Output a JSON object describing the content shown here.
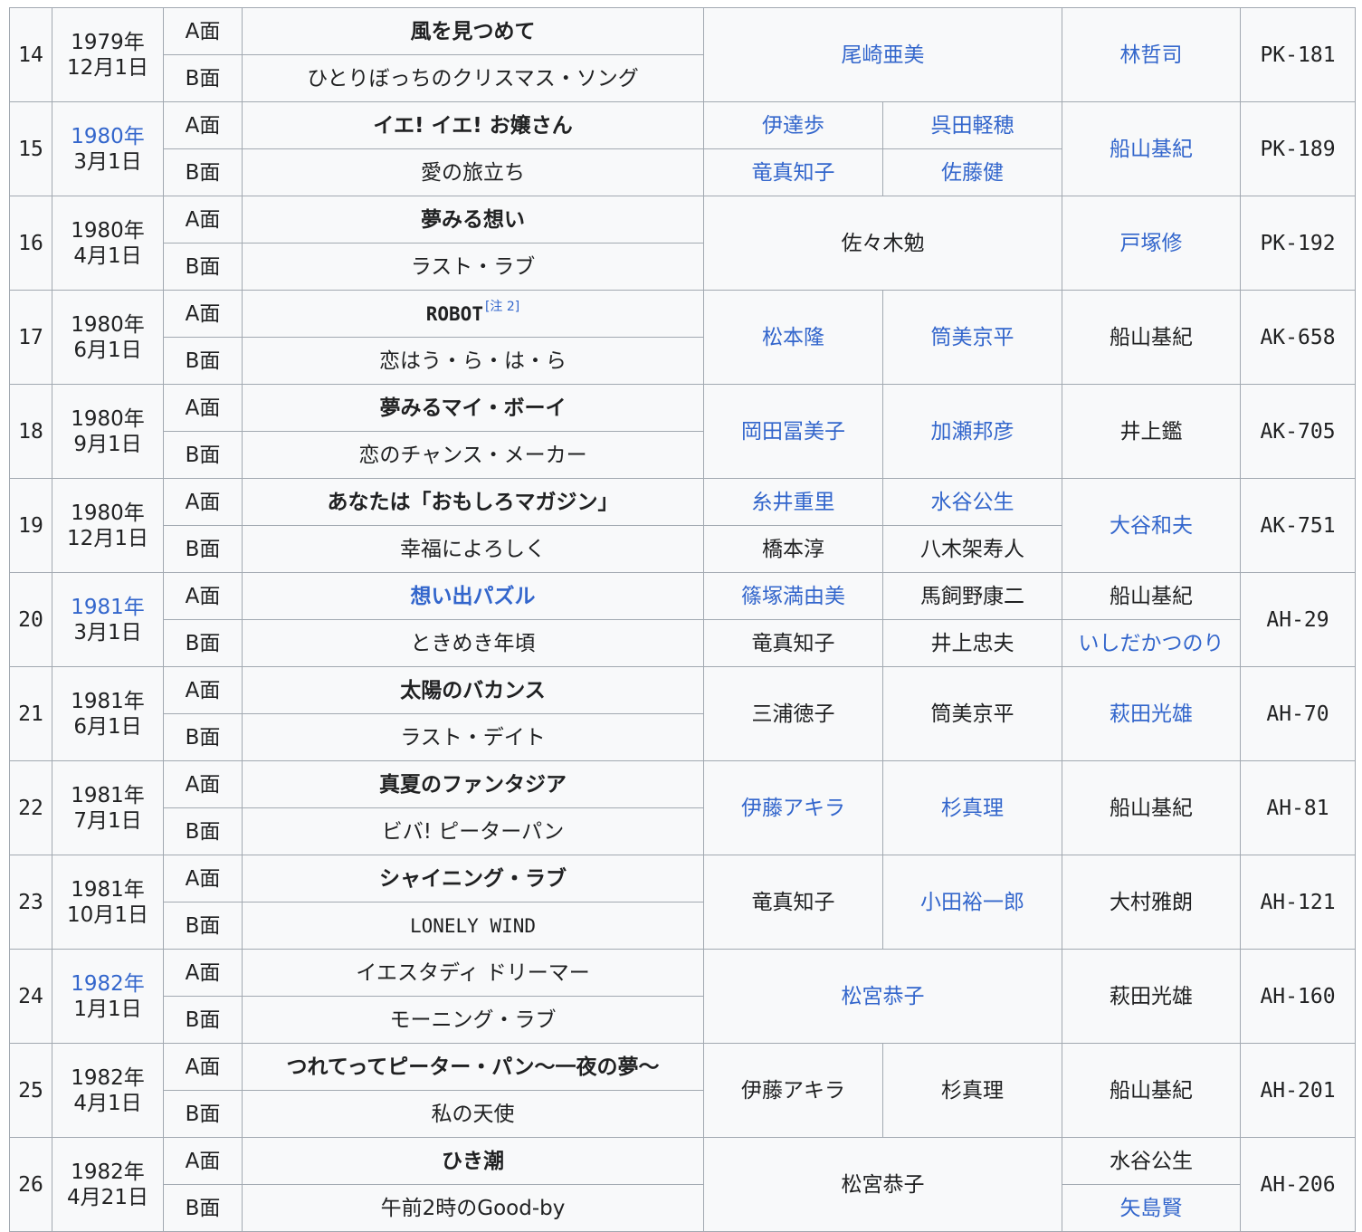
{
  "rows": [
    {
      "no": "14",
      "year": "1979年",
      "date": "12月1日",
      "a": {
        "side": "A面",
        "title": "風を見つめて"
      },
      "b": {
        "side": "B面",
        "title": "ひとりぼっちのクリスマス・ソング"
      },
      "lyricist": "尾崎亜美",
      "arranger": "林哲司",
      "code": "PK-181"
    },
    {
      "no": "15",
      "year": "1980年",
      "date": "3月1日",
      "a": {
        "side": "A面",
        "title": "イエ! イエ! お嬢さん",
        "lyricist": "伊達歩",
        "composer": "呉田軽穂"
      },
      "b": {
        "side": "B面",
        "title": "愛の旅立ち",
        "lyricist": "竜真知子",
        "composer": "佐藤健"
      },
      "arranger": "船山基紀",
      "code": "PK-189"
    },
    {
      "no": "16",
      "year": "1980年",
      "date": "4月1日",
      "a": {
        "side": "A面",
        "title": "夢みる想い"
      },
      "b": {
        "side": "B面",
        "title": "ラスト・ラブ"
      },
      "lyricist": "佐々木勉",
      "arranger": "戸塚修",
      "code": "PK-192"
    },
    {
      "no": "17",
      "year": "1980年",
      "date": "6月1日",
      "a": {
        "side": "A面",
        "title": "ROBOT",
        "note": "[注 2]"
      },
      "b": {
        "side": "B面",
        "title": "恋はう・ら・は・ら"
      },
      "lyricist": "松本隆",
      "composer": "筒美京平",
      "arranger": "船山基紀",
      "code": "AK-658"
    },
    {
      "no": "18",
      "year": "1980年",
      "date": "9月1日",
      "a": {
        "side": "A面",
        "title": "夢みるマイ・ボーイ"
      },
      "b": {
        "side": "B面",
        "title": "恋のチャンス・メーカー"
      },
      "lyricist": "岡田冨美子",
      "composer": "加瀬邦彦",
      "arranger": "井上鑑",
      "code": "AK-705"
    },
    {
      "no": "19",
      "year": "1980年",
      "date": "12月1日",
      "a": {
        "side": "A面",
        "title": "あなたは「おもしろマガジン」",
        "lyricist": "糸井重里",
        "composer": "水谷公生"
      },
      "b": {
        "side": "B面",
        "title": "幸福によろしく",
        "lyricist": "橋本淳",
        "composer": "八木架寿人"
      },
      "arranger": "大谷和夫",
      "code": "AK-751"
    },
    {
      "no": "20",
      "year": "1981年",
      "date": "3月1日",
      "a": {
        "side": "A面",
        "title": "想い出パズル",
        "lyricist": "篠塚満由美",
        "composer": "馬飼野康二",
        "arranger": "船山基紀"
      },
      "b": {
        "side": "B面",
        "title": "ときめき年頃",
        "lyricist": "竜真知子",
        "composer": "井上忠夫",
        "arranger": "いしだかつのり"
      },
      "code": "AH-29"
    },
    {
      "no": "21",
      "year": "1981年",
      "date": "6月1日",
      "a": {
        "side": "A面",
        "title": "太陽のバカンス"
      },
      "b": {
        "side": "B面",
        "title": "ラスト・デイト"
      },
      "lyricist": "三浦徳子",
      "composer": "筒美京平",
      "arranger": "萩田光雄",
      "code": "AH-70"
    },
    {
      "no": "22",
      "year": "1981年",
      "date": "7月1日",
      "a": {
        "side": "A面",
        "title": "真夏のファンタジア"
      },
      "b": {
        "side": "B面",
        "title": "ビバ! ピーターパン"
      },
      "lyricist": "伊藤アキラ",
      "composer": "杉真理",
      "arranger": "船山基紀",
      "code": "AH-81"
    },
    {
      "no": "23",
      "year": "1981年",
      "date": "10月1日",
      "a": {
        "side": "A面",
        "title": "シャイニング・ラブ"
      },
      "b": {
        "side": "B面",
        "title": "LONELY WIND"
      },
      "lyricist": "竜真知子",
      "composer": "小田裕一郎",
      "arranger": "大村雅朗",
      "code": "AH-121"
    },
    {
      "no": "24",
      "year": "1982年",
      "date": "1月1日",
      "a": {
        "side": "A面",
        "title": "イエスタディ ドリーマー"
      },
      "b": {
        "side": "B面",
        "title": "モーニング・ラブ"
      },
      "lyricist": "松宮恭子",
      "arranger": "萩田光雄",
      "code": "AH-160"
    },
    {
      "no": "25",
      "year": "1982年",
      "date": "4月1日",
      "a": {
        "side": "A面",
        "title": "つれてってピーター・パン〜一夜の夢〜"
      },
      "b": {
        "side": "B面",
        "title": "私の天使"
      },
      "lyricist": "伊藤アキラ",
      "composer": "杉真理",
      "arranger": "船山基紀",
      "code": "AH-201"
    },
    {
      "no": "26",
      "year": "1982年",
      "date": "4月21日",
      "a": {
        "side": "A面",
        "title": "ひき潮",
        "arranger": "水谷公生"
      },
      "b": {
        "side": "B面",
        "title": "午前2時のGood-by",
        "arranger": "矢島賢"
      },
      "lyricist": "松宮恭子",
      "code": "AH-206"
    }
  ],
  "colors": {
    "link": "#3366cc",
    "border": "#a2a9b1",
    "cell_bg": "#f8f9fa",
    "text": "#202122"
  }
}
